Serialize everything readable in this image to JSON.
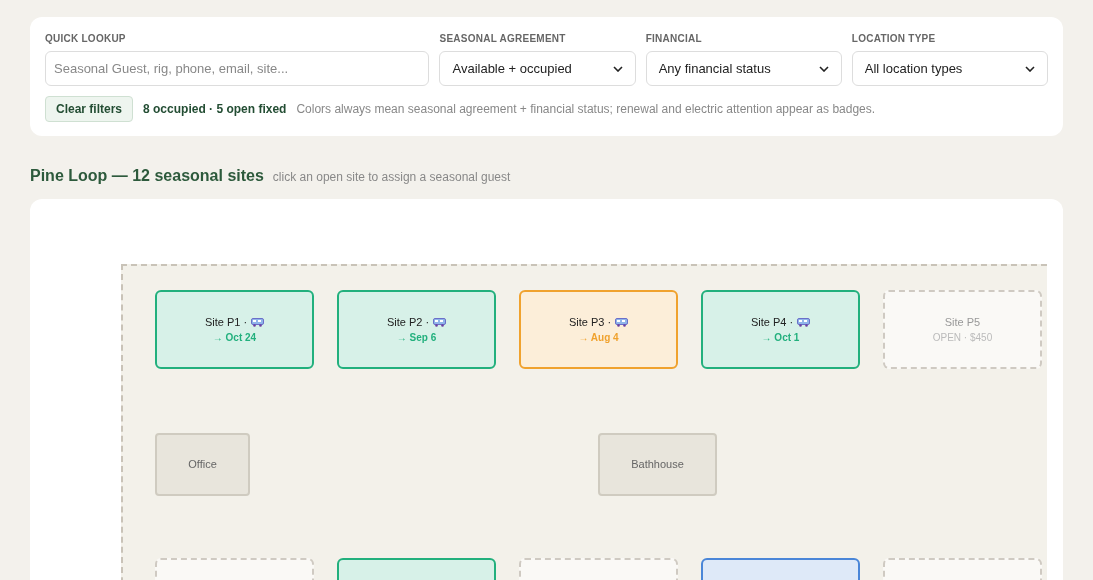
{
  "filters": {
    "quick_lookup": {
      "label": "QUICK LOOKUP",
      "placeholder": "Seasonal Guest, rig, phone, email, site..."
    },
    "selects": [
      {
        "label": "SEASONAL AGREEMENT",
        "value": "Available + occupied"
      },
      {
        "label": "FINANCIAL",
        "value": "Any financial status"
      },
      {
        "label": "LOCATION TYPE",
        "value": "All location types"
      }
    ],
    "clear_button": "Clear filters",
    "summary": "8 occupied · 5 open fixed",
    "legend": "Colors always mean seasonal agreement + financial status; renewal and electric attention appear as badges."
  },
  "section": {
    "title": "Pine Loop — 12 seasonal sites",
    "hint": "click an open site to assign a seasonal guest"
  },
  "map": {
    "sites": [
      {
        "kind": "occupied",
        "name": "Site P1 ·",
        "date": "→ Oct 24",
        "color": "#22b07d"
      },
      {
        "kind": "occupied",
        "name": "Site P2 ·",
        "date": "→ Sep 6",
        "color": "#22b07d"
      },
      {
        "kind": "occupied",
        "name": "Site P3 ·",
        "date": "→ Aug 4",
        "color": "#f0a22e"
      },
      {
        "kind": "occupied",
        "name": "Site P4 ·",
        "date": "→ Oct 1",
        "color": "#22b07d"
      },
      {
        "kind": "open",
        "name": "Site P5",
        "price": "OPEN · $450"
      },
      {
        "kind": "facility",
        "name": "Office"
      },
      {
        "kind": "facility",
        "name": "Bathhouse"
      },
      {
        "kind": "open"
      },
      {
        "kind": "occupied",
        "color": "#22b07d"
      },
      {
        "kind": "open"
      },
      {
        "kind": "occupied",
        "color": "#4a86d8"
      },
      {
        "kind": "open"
      }
    ]
  }
}
